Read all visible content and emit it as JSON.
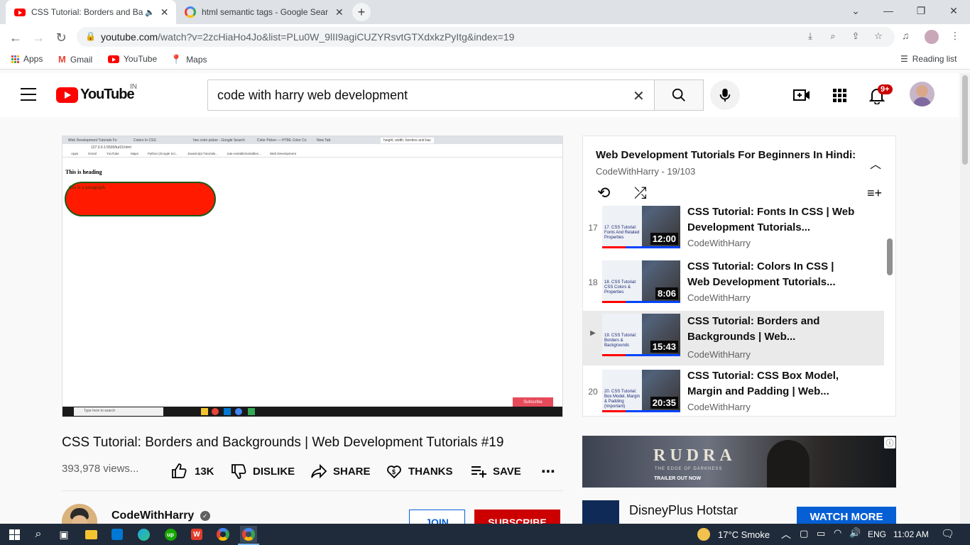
{
  "browser": {
    "tabs": [
      {
        "title": "CSS Tutorial: Borders and Ba",
        "active": true,
        "icon": "youtube-icon",
        "audio": true
      },
      {
        "title": "html semantic tags - Google Sear",
        "active": false,
        "icon": "google-icon"
      }
    ],
    "url_host": "youtube.com",
    "url_path": "/watch?v=2zcHiaHo4Jo&list=PLu0W_9lII9agiCUZYRsvtGTXdxkzPyItg&index=19",
    "bookmarks": [
      "Apps",
      "Gmail",
      "YouTube",
      "Maps"
    ],
    "reading_list": "Reading list"
  },
  "youtube": {
    "logo_text": "YouTube",
    "region": "IN",
    "search_value": "code with harry web development",
    "notification_badge": "9+"
  },
  "player": {
    "inner_tabs": [
      "Web Development Tutorials Fo",
      "Colors In CSS",
      "hex color picker - Google Search",
      "Color Picker — HTML Color Co",
      "New Tab",
      "height, width, borders and bac"
    ],
    "inner_url": "127.0.0.1:5500/tut19.html",
    "inner_bookmarks": [
      "Apps",
      "Gmail",
      "YouTube",
      "Maps",
      "Python (Google Sci...",
      "JavaScript Tutorials...",
      "tute-variable/variables...",
      "Web Development"
    ],
    "inner_heading": "This is heading",
    "inner_paragraph": "this is a paragraph",
    "inner_search": "Type here to search",
    "subscribe_badge": "Subscribe"
  },
  "video": {
    "title": "CSS Tutorial: Borders and Backgrounds | Web Development Tutorials #19",
    "views": "393,978 views...",
    "likes": "13K",
    "dislike_label": "DISLIKE",
    "share_label": "SHARE",
    "thanks_label": "THANKS",
    "save_label": "SAVE"
  },
  "channel": {
    "name": "CodeWithHarry",
    "join_label": "JOIN",
    "subscribe_label": "SUBSCRIBE"
  },
  "playlist": {
    "title": "Web Development Tutorials For Beginners In Hindi:",
    "meta": "CodeWithHarry - 19/103",
    "items": [
      {
        "index": "17",
        "title": "CSS Tutorial: Fonts In CSS | Web Development Tutorials...",
        "channel": "CodeWithHarry",
        "duration": "12:00",
        "thumb_label": "17. CSS Tutorial: Fonts And Related Properties",
        "current": false
      },
      {
        "index": "18",
        "title": "CSS Tutorial: Colors In CSS | Web Development Tutorials...",
        "channel": "CodeWithHarry",
        "duration": "8:06",
        "thumb_label": "18. CSS Tutorial: CSS Colors & Properties",
        "current": false
      },
      {
        "index": "▶",
        "title": "CSS Tutorial: Borders and Backgrounds | Web...",
        "channel": "CodeWithHarry",
        "duration": "15:43",
        "thumb_label": "19. CSS Tutorial: Borders & Backgrounds",
        "current": true
      },
      {
        "index": "20",
        "title": "CSS Tutorial: CSS Box Model, Margin and Padding | Web...",
        "channel": "CodeWithHarry",
        "duration": "20:35",
        "thumb_label": "20. CSS Tutorial: Box Model, Margin & Padding (Important)",
        "current": false
      }
    ]
  },
  "ad": {
    "brand": "RUDRA",
    "tagline": "THE EDGE OF DARKNESS",
    "trailer": "TRAILER OUT NOW",
    "advertiser": "DisneyPlus Hotstar",
    "cta": "WATCH MORE"
  },
  "taskbar": {
    "weather": "17°C  Smoke",
    "language": "ENG",
    "time": "11:02 AM"
  },
  "colors": {
    "youtube_red": "#ff0000",
    "link_blue": "#065fd4",
    "subscribe_red": "#cc0000"
  }
}
